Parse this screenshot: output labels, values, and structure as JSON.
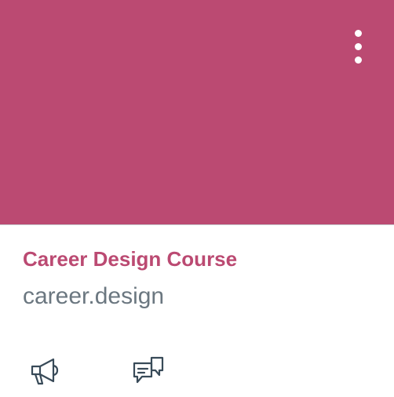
{
  "colors": {
    "course_color": "#bb4a72",
    "title_color": "#bb4a72",
    "icon_color": "#384a58"
  },
  "course": {
    "name": "Career Design Course",
    "code": "career.design"
  },
  "menu": {
    "icon": "more-vertical-icon"
  },
  "actions": [
    {
      "icon": "megaphone-icon"
    },
    {
      "icon": "discussions-icon"
    }
  ]
}
